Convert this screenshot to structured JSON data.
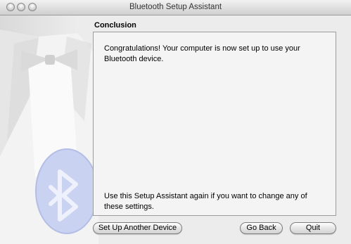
{
  "window": {
    "title": "Bluetooth Setup Assistant"
  },
  "section": {
    "title": "Conclusion"
  },
  "panel": {
    "message_top": "Congratulations! Your computer is now set up to use your Bluetooth device.",
    "message_bottom": "Use this Setup Assistant again if you want to change any of these settings."
  },
  "buttons": {
    "setup_another": "Set Up Another Device",
    "go_back": "Go Back",
    "quit": "Quit"
  },
  "icons": {
    "background_art": "tuxedo-bowtie-bluetooth-illustration"
  }
}
